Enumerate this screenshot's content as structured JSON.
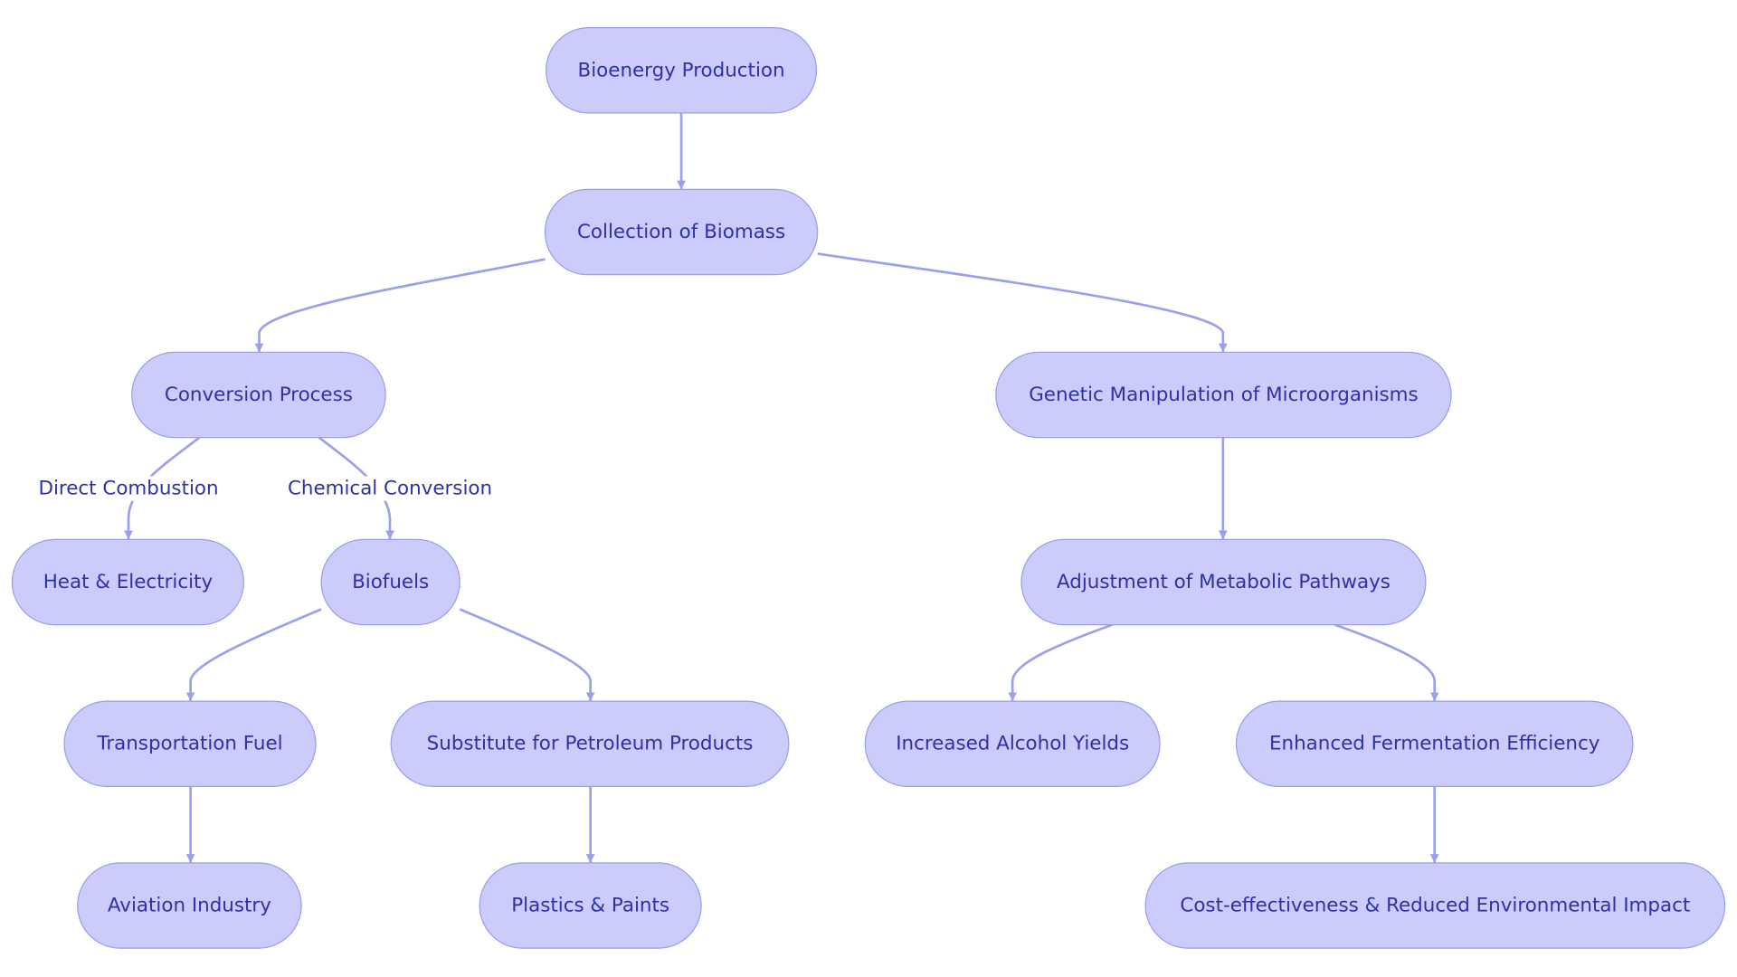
{
  "title": "Bioenergy Production flowchart",
  "colors": {
    "node_fill": "#cbcbfc",
    "node_stroke": "#9c9de8",
    "node_text": "#2f31a6",
    "edge": "#9c9fec",
    "edge_label_text": "#2f31a6",
    "background": "#ffffff"
  },
  "nodes": [
    {
      "id": "bioenergy",
      "label": "Bioenergy Production"
    },
    {
      "id": "collection",
      "label": "Collection of Biomass"
    },
    {
      "id": "conversion",
      "label": "Conversion Process"
    },
    {
      "id": "genetic",
      "label": "Genetic Manipulation of Microorganisms"
    },
    {
      "id": "heat",
      "label": "Heat & Electricity"
    },
    {
      "id": "biofuels",
      "label": "Biofuels"
    },
    {
      "id": "metabolic",
      "label": "Adjustment of Metabolic Pathways"
    },
    {
      "id": "transport",
      "label": "Transportation Fuel"
    },
    {
      "id": "petroleum",
      "label": "Substitute for Petroleum Products"
    },
    {
      "id": "alcohol",
      "label": "Increased Alcohol Yields"
    },
    {
      "id": "fermentation",
      "label": "Enhanced Fermentation Efficiency"
    },
    {
      "id": "aviation",
      "label": "Aviation Industry"
    },
    {
      "id": "plastics",
      "label": "Plastics & Paints"
    },
    {
      "id": "cost",
      "label": "Cost-effectiveness & Reduced Environmental Impact"
    }
  ],
  "edges": [
    {
      "from": "bioenergy",
      "to": "collection",
      "label": ""
    },
    {
      "from": "collection",
      "to": "conversion",
      "label": ""
    },
    {
      "from": "collection",
      "to": "genetic",
      "label": ""
    },
    {
      "from": "conversion",
      "to": "heat",
      "label": "Direct Combustion"
    },
    {
      "from": "conversion",
      "to": "biofuels",
      "label": "Chemical Conversion"
    },
    {
      "from": "genetic",
      "to": "metabolic",
      "label": ""
    },
    {
      "from": "biofuels",
      "to": "transport",
      "label": ""
    },
    {
      "from": "biofuels",
      "to": "petroleum",
      "label": ""
    },
    {
      "from": "metabolic",
      "to": "alcohol",
      "label": ""
    },
    {
      "from": "metabolic",
      "to": "fermentation",
      "label": ""
    },
    {
      "from": "transport",
      "to": "aviation",
      "label": ""
    },
    {
      "from": "petroleum",
      "to": "plastics",
      "label": ""
    },
    {
      "from": "fermentation",
      "to": "cost",
      "label": ""
    }
  ]
}
